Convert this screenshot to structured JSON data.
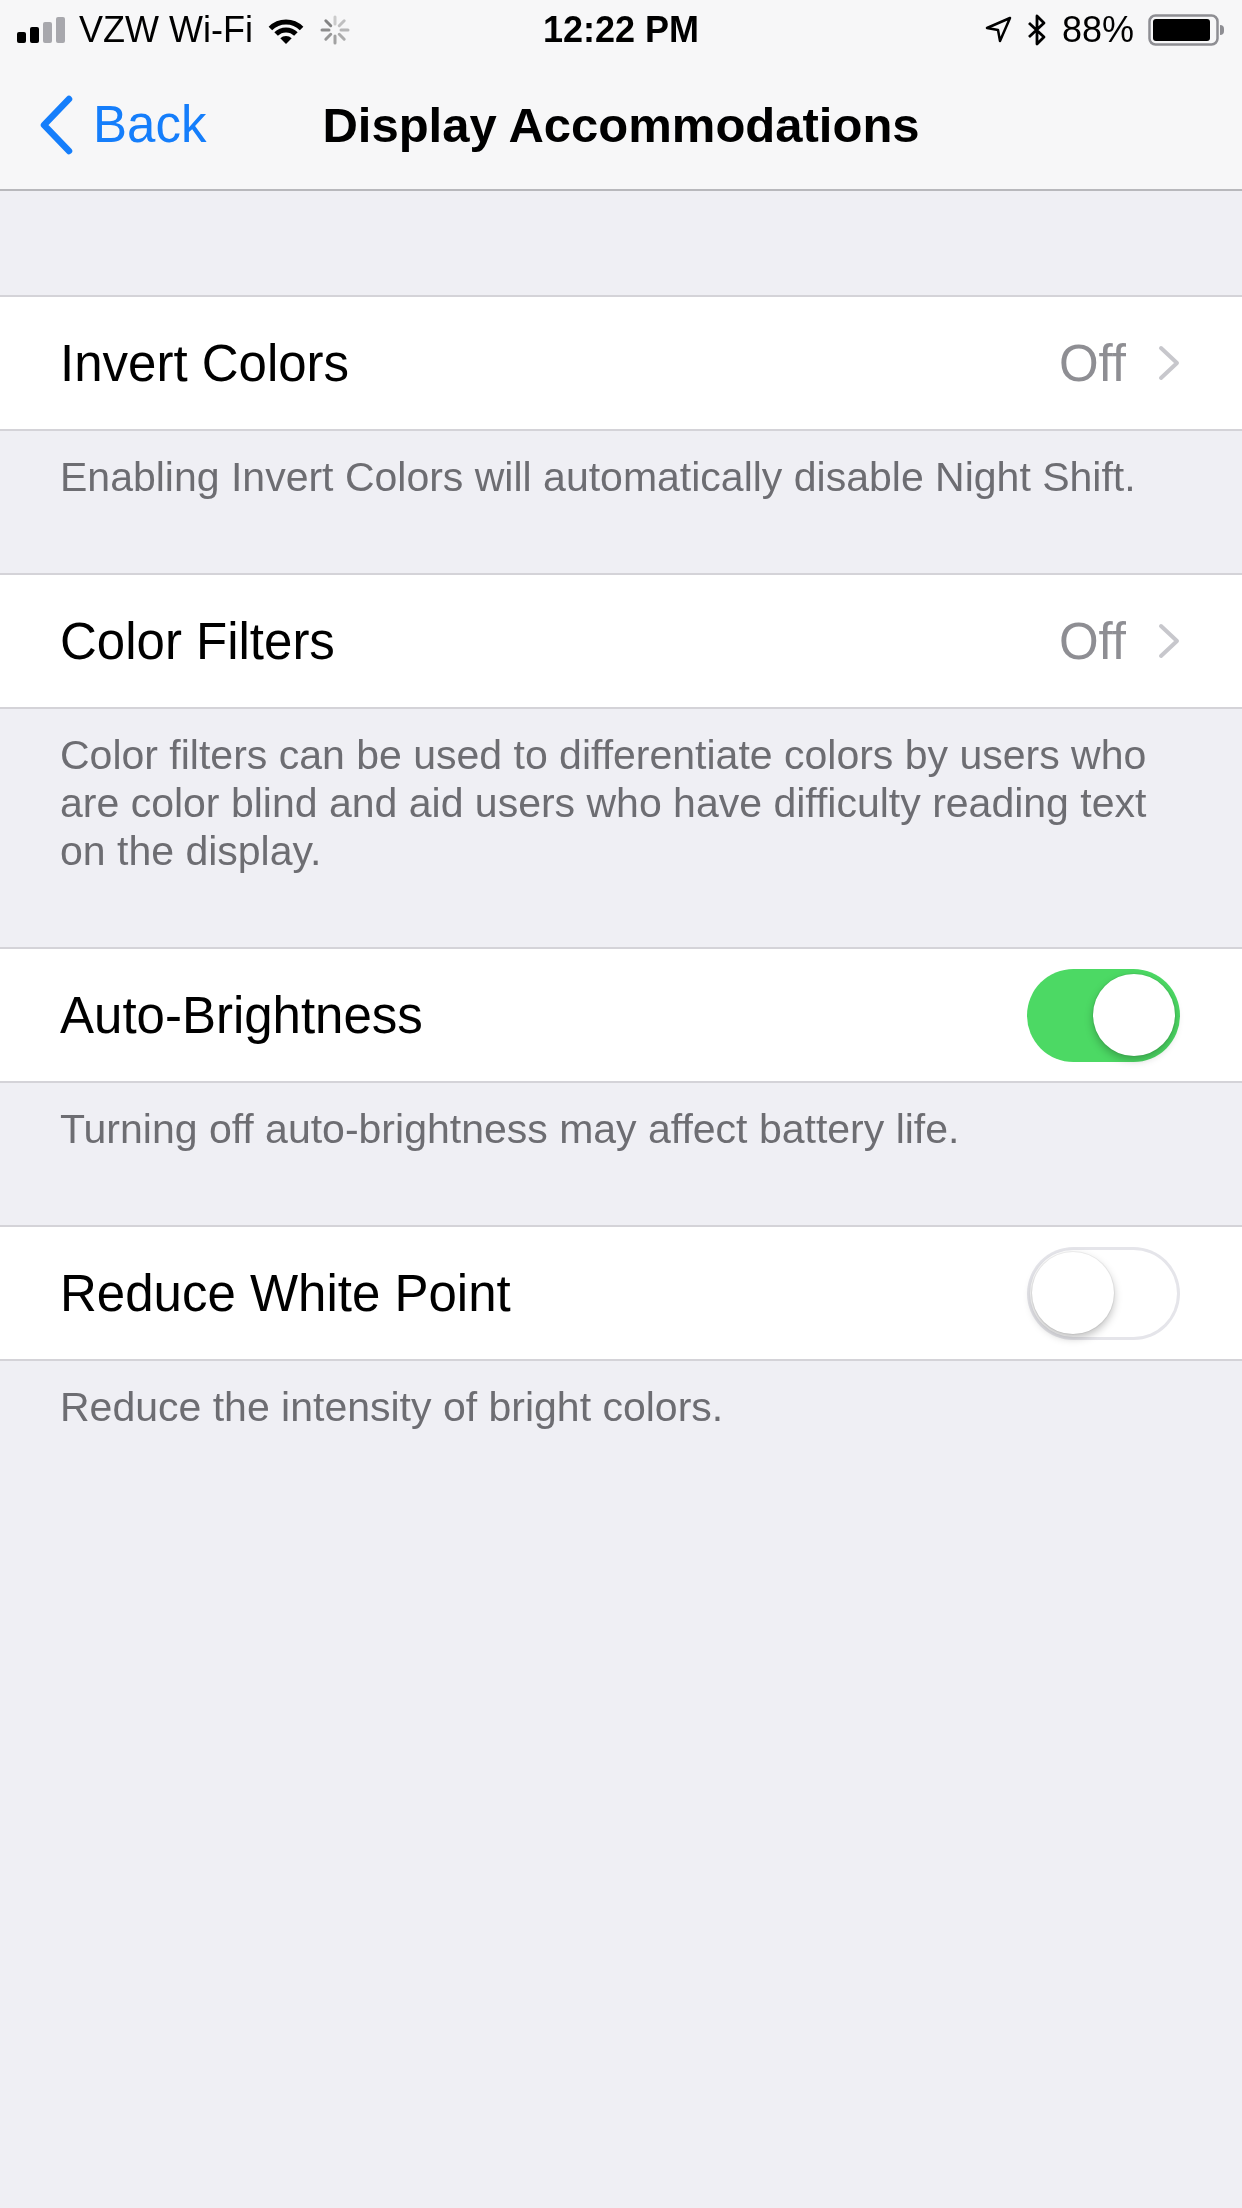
{
  "status_bar": {
    "carrier": "VZW Wi-Fi",
    "time": "12:22 PM",
    "battery": "88%"
  },
  "nav_bar": {
    "back": "Back",
    "title": "Display Accommodations"
  },
  "sections": [
    {
      "kind": "disclosure",
      "label": "Invert Colors",
      "value": "Off",
      "footer": "Enabling Invert Colors will automatically disable Night Shift."
    },
    {
      "kind": "disclosure",
      "label": "Color Filters",
      "value": "Off",
      "footer": "Color filters can be used to differentiate colors by users who are color blind and aid users who have difficulty reading text on the display."
    },
    {
      "kind": "toggle",
      "label": "Auto-Brightness",
      "on": true,
      "footer": "Turning off auto-brightness may affect battery life."
    },
    {
      "kind": "toggle",
      "label": "Reduce White Point",
      "on": false,
      "footer": "Reduce the intensity of bright colors."
    }
  ]
}
